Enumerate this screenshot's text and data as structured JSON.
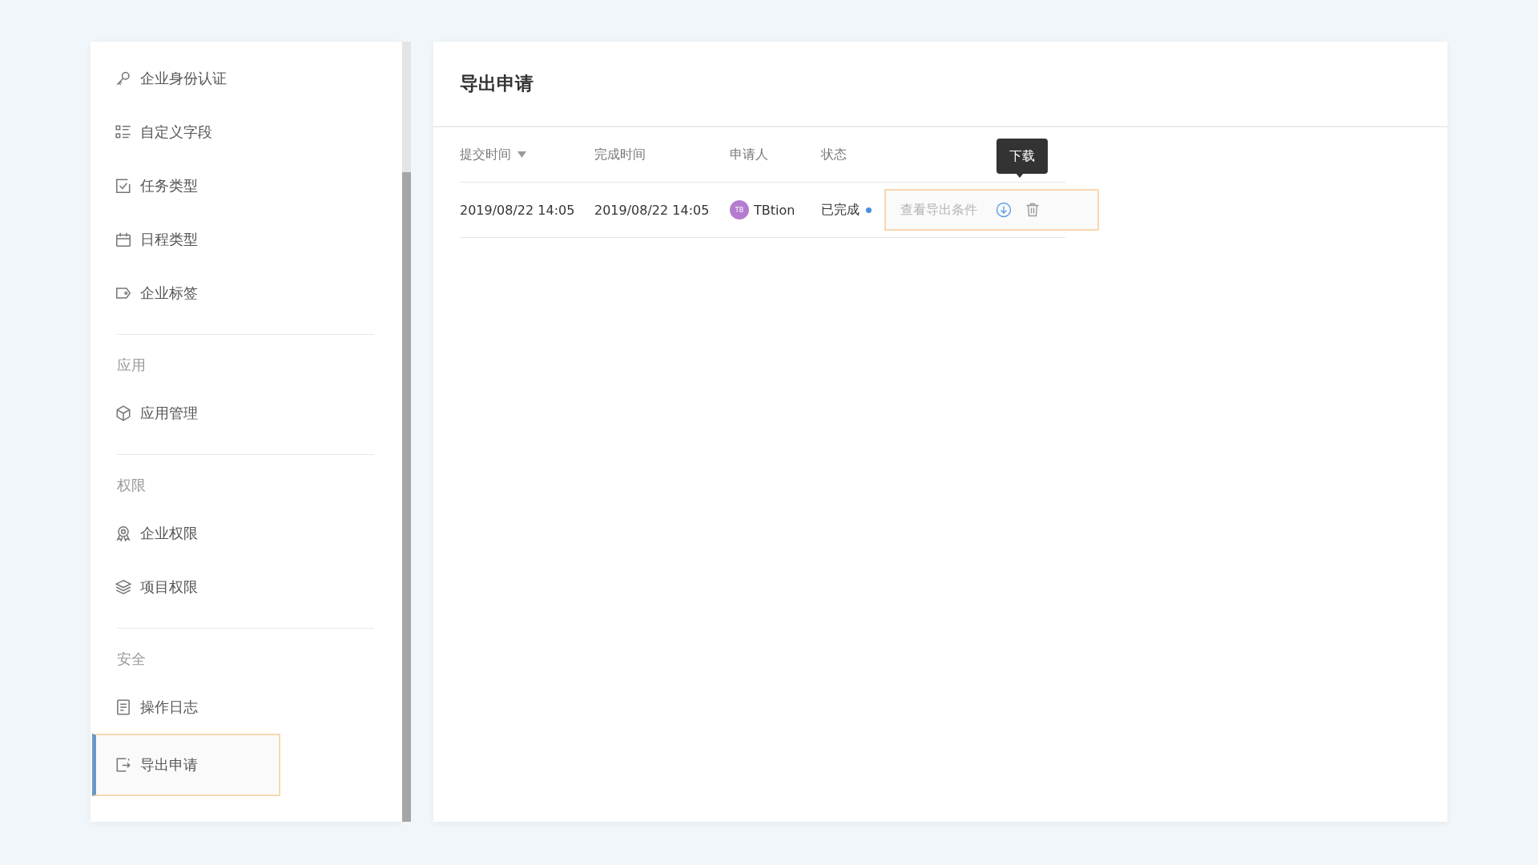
{
  "sidebar": {
    "groups": [
      {
        "items": [
          {
            "kind": "key",
            "label": "企业身份认证",
            "selected": false
          },
          {
            "kind": "fields",
            "label": "自定义字段",
            "selected": false
          },
          {
            "kind": "task",
            "label": "任务类型",
            "selected": false
          },
          {
            "kind": "calendar",
            "label": "日程类型",
            "selected": false
          },
          {
            "kind": "tag",
            "label": "企业标签",
            "selected": false
          }
        ]
      },
      {
        "title": "应用",
        "items": [
          {
            "kind": "cube",
            "label": "应用管理",
            "selected": false
          }
        ]
      },
      {
        "title": "权限",
        "items": [
          {
            "kind": "badge",
            "label": "企业权限",
            "selected": false
          },
          {
            "kind": "layers",
            "label": "项目权限",
            "selected": false
          }
        ]
      },
      {
        "title": "安全",
        "items": [
          {
            "kind": "document",
            "label": "操作日志",
            "selected": false
          },
          {
            "kind": "export",
            "label": "导出申请",
            "selected": true
          }
        ]
      }
    ]
  },
  "main": {
    "title": "导出申请",
    "table": {
      "columns": [
        {
          "label": "提交时间",
          "sorted": true
        },
        {
          "label": "完成时间",
          "sorted": false
        },
        {
          "label": "申请人",
          "sorted": false
        },
        {
          "label": "状态",
          "sorted": false
        }
      ],
      "rows": [
        {
          "submitted": "2019/08/22 14:05",
          "completed": "2019/08/22 14:05",
          "applicant": {
            "initials": "TB",
            "name": "TBtion"
          },
          "status": "已完成",
          "actions": {
            "link": "查看导出条件",
            "tooltip": "下载"
          }
        }
      ]
    }
  }
}
